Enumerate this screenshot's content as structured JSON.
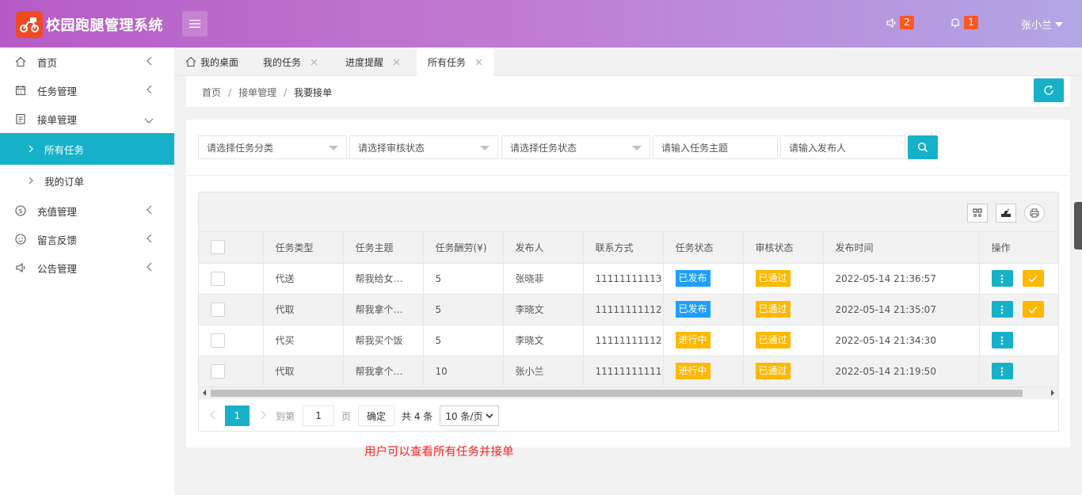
{
  "app": {
    "title": "校园跑腿管理系统"
  },
  "header": {
    "announce_count": "2",
    "notice_count": "1",
    "user": "张小兰"
  },
  "sidebar": {
    "items": [
      {
        "label": "首页"
      },
      {
        "label": "任务管理"
      },
      {
        "label": "接单管理"
      },
      {
        "label": "所有任务"
      },
      {
        "label": "我的订单"
      },
      {
        "label": "充值管理"
      },
      {
        "label": "留言反馈"
      },
      {
        "label": "公告管理"
      }
    ]
  },
  "tabs": [
    {
      "label": "我的桌面"
    },
    {
      "label": "我的任务"
    },
    {
      "label": "进度提醒"
    },
    {
      "label": "所有任务"
    }
  ],
  "breadcrumb": {
    "items": [
      "首页",
      "接单管理",
      "我要接单"
    ],
    "sep": "/"
  },
  "filters": {
    "category": "请选择任务分类",
    "audit": "请选择审核状态",
    "status": "请选择任务状态",
    "subject_placeholder": "请输入任务主题",
    "publisher_placeholder": "请输入发布人"
  },
  "table": {
    "columns": [
      "任务类型",
      "任务主题",
      "任务酬劳(¥)",
      "发布人",
      "联系方式",
      "任务状态",
      "审核状态",
      "发布时间",
      "操作"
    ],
    "rows": [
      {
        "type": "代送",
        "subject": "帮我给女…",
        "reward": "5",
        "publisher": "张晓菲",
        "phone": "11111111113",
        "status": "已发布",
        "audit": "已通过",
        "time": "2022-05-14 21:36:57"
      },
      {
        "type": "代取",
        "subject": "帮我拿个…",
        "reward": "5",
        "publisher": "李晓文",
        "phone": "11111111112",
        "status": "已发布",
        "audit": "已通过",
        "time": "2022-05-14 21:35:07"
      },
      {
        "type": "代买",
        "subject": "帮我买个饭",
        "reward": "5",
        "publisher": "李晓文",
        "phone": "11111111112",
        "status": "进行中",
        "audit": "已通过",
        "time": "2022-05-14 21:34:30"
      },
      {
        "type": "代取",
        "subject": "帮我拿个…",
        "reward": "10",
        "publisher": "张小兰",
        "phone": "11111111111",
        "status": "进行中",
        "audit": "已通过",
        "time": "2022-05-14 21:19:50"
      }
    ]
  },
  "pager": {
    "current": "1",
    "goto_label": "到第",
    "goto_value": "1",
    "page_label": "页",
    "confirm": "确定",
    "total": "共 4 条",
    "per_page": "10 条/页"
  },
  "note": "用户可以查看所有任务并接单",
  "colors": {
    "accent": "#16b1c8",
    "blue_tag": "#1e9fff",
    "orange_tag": "#ffb800",
    "badge": "#ff5722"
  }
}
